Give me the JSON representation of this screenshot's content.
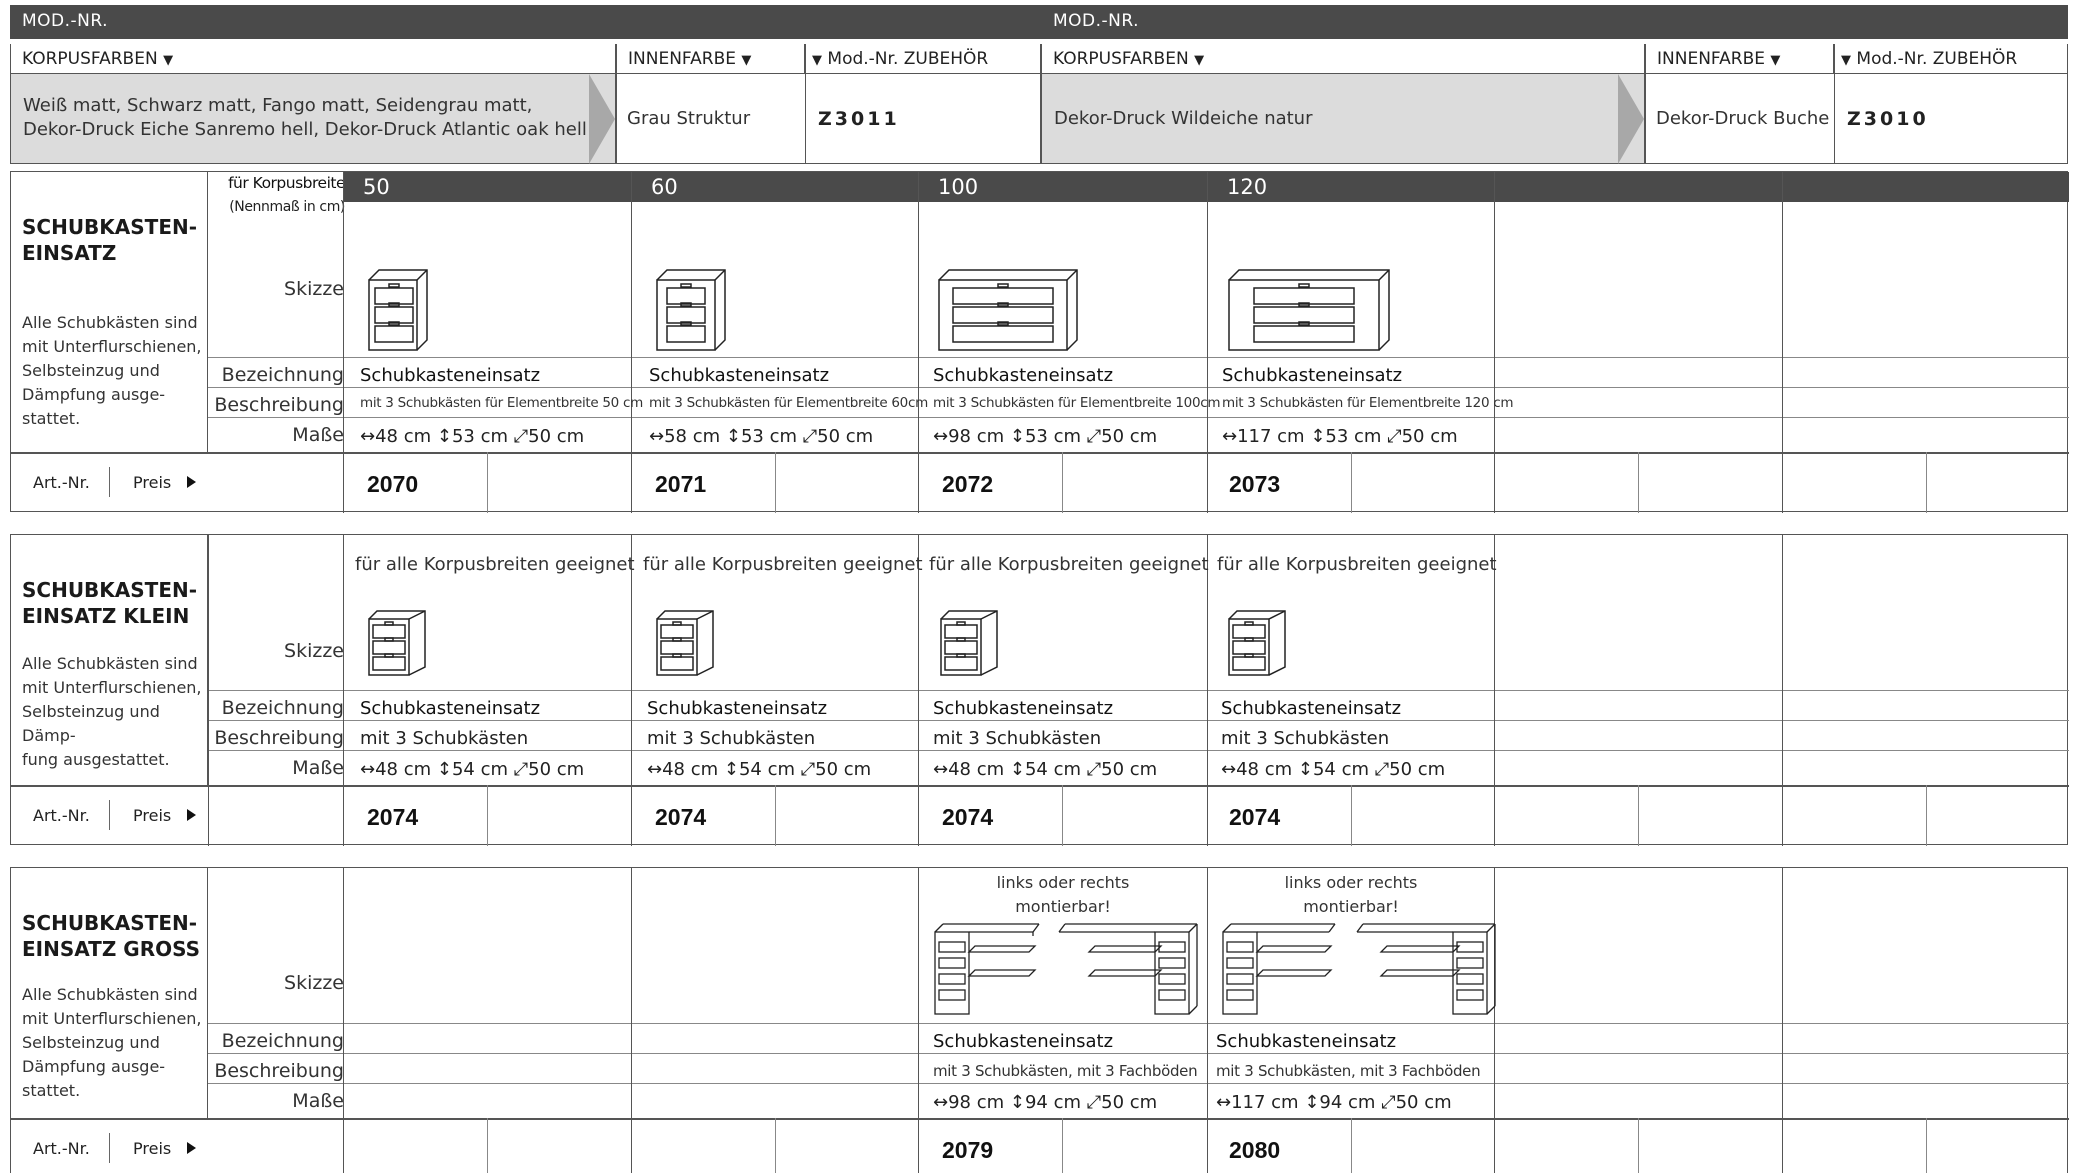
{
  "header": {
    "left": {
      "mod_label": "MOD.-NR.",
      "korpus_label": "KORPUSFARBEN",
      "innen_label": "INNENFARBE",
      "zub_label": "Mod.-Nr. ZUBEHÖR",
      "colors_line1": "Weiß matt, Schwarz matt, Fango matt, Seidengrau matt,",
      "colors_line2": "Dekor-Druck Eiche Sanremo hell, Dekor-Druck Atlantic oak hell",
      "innen_value": "Grau Struktur",
      "zub_value": "Z3011"
    },
    "right": {
      "mod_label": "MOD.-NR.",
      "korpus_label": "KORPUSFARBEN",
      "innen_label": "INNENFARBE",
      "zub_label": "Mod.-Nr. ZUBEHÖR",
      "colors_line1": "Dekor-Druck Wildeiche natur",
      "innen_value": "Dekor-Druck Buche",
      "zub_value": "Z3010"
    },
    "dropdown_arrow": "▼"
  },
  "labels": {
    "width_for": "für Korpusbreite",
    "width_unit": "(Nennmaß in cm)",
    "skizze": "Skizze",
    "bezeichnung": "Bezeichnung",
    "beschreibung": "Beschreibung",
    "masse": "Maße",
    "artnr": "Art.-Nr.",
    "preis": "Preis"
  },
  "widths": [
    "50",
    "60",
    "100",
    "120"
  ],
  "sections": [
    {
      "title": "SCHUBKASTEN-\nEINSATZ",
      "desc": "Alle Schubkästen sind\nmit Unterflurschienen,\nSelbsteinzug und\nDämpfung ausge-\nstattet.",
      "products": [
        {
          "name": "Schubkasteneinsatz",
          "desc": "mit 3 Schubkästen für Elementbreite 50 cm",
          "w": "↔48 cm",
          "h": "↕53 cm",
          "d": "⤢50 cm",
          "art": "2070"
        },
        {
          "name": "Schubkasteneinsatz",
          "desc": "mit 3 Schubkästen für Elementbreite 60cm",
          "w": "↔58 cm",
          "h": "↕53 cm",
          "d": "⤢50 cm",
          "art": "2071"
        },
        {
          "name": "Schubkasteneinsatz",
          "desc": "mit 3 Schubkästen für Elementbreite 100cm",
          "w": "↔98 cm",
          "h": "↕53 cm",
          "d": "⤢50 cm",
          "art": "2072"
        },
        {
          "name": "Schubkasteneinsatz",
          "desc": "mit 3 Schubkästen für Elementbreite 120 cm",
          "w": "↔117 cm",
          "h": "↕53 cm",
          "d": "⤢50 cm",
          "art": "2073"
        }
      ]
    },
    {
      "title": "SCHUBKASTEN-\nEINSATZ KLEIN",
      "desc": "Alle Schubkästen sind\nmit Unterflurschienen,\nSelbsteinzug und Dämp-\nfung ausgestattet.",
      "hint": "für alle Korpusbreiten geeignet",
      "products": [
        {
          "name": "Schubkasteneinsatz",
          "desc": "mit 3 Schubkästen",
          "w": "↔48 cm",
          "h": "↕54 cm",
          "d": "⤢50 cm",
          "art": "2074"
        },
        {
          "name": "Schubkasteneinsatz",
          "desc": "mit 3 Schubkästen",
          "w": "↔48 cm",
          "h": "↕54 cm",
          "d": "⤢50 cm",
          "art": "2074"
        },
        {
          "name": "Schubkasteneinsatz",
          "desc": "mit 3 Schubkästen",
          "w": "↔48 cm",
          "h": "↕54 cm",
          "d": "⤢50 cm",
          "art": "2074"
        },
        {
          "name": "Schubkasteneinsatz",
          "desc": "mit 3 Schubkästen",
          "w": "↔48 cm",
          "h": "↕54 cm",
          "d": "⤢50 cm",
          "art": "2074"
        }
      ]
    },
    {
      "title": "SCHUBKASTEN-\nEINSATZ GROSS",
      "desc": "Alle Schubkästen sind\nmit Unterflurschienen,\nSelbsteinzug und\nDämpfung ausge-\nstattet.",
      "note_line1": "links oder rechts",
      "note_line2": "montierbar!",
      "products": [
        {
          "name": "Schubkasteneinsatz",
          "desc": "mit 3 Schubkästen, mit 3 Fachböden",
          "w": "↔98 cm",
          "h": "↕94 cm",
          "d": "⤢50 cm",
          "art": "2079"
        },
        {
          "name": "Schubkasteneinsatz",
          "desc": "mit 3 Schubkästen, mit 3 Fachböden",
          "w": "↔117 cm",
          "h": "↕94 cm",
          "d": "⤢50 cm",
          "art": "2080"
        }
      ]
    }
  ]
}
